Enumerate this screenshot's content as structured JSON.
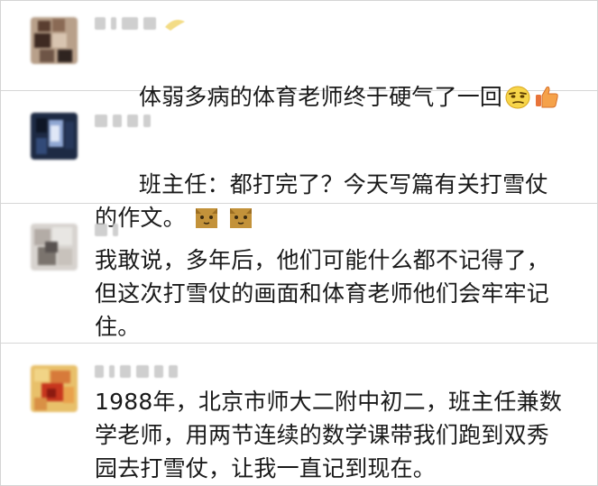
{
  "comments": [
    {
      "text": "体弱多病的体育老师终于硬气了一回",
      "trailing_icons": [
        "smug-face-icon",
        "thumbs-up-icon"
      ]
    },
    {
      "text": "班主任：都打完了？今天写篇有关打雪仗的作文。",
      "trailing_icons": [
        "cat-face-icon",
        "cat-face-icon"
      ]
    },
    {
      "text": "我敢说，多年后，他们可能什么都不记得了，但这次打雪仗的画面和体育老师他们会牢牢记住。",
      "trailing_icons": []
    },
    {
      "text": "1988年，北京市师大二附中初二，班主任兼数学老师，用两节连续的数学课带我们跑到双秀园去打雪仗，让我一直记到现在。",
      "trailing_icons": []
    }
  ],
  "colors": {
    "text": "#1a1a1a",
    "divider": "#d6d6d6",
    "nickname_blur": "#cfcfcf"
  }
}
